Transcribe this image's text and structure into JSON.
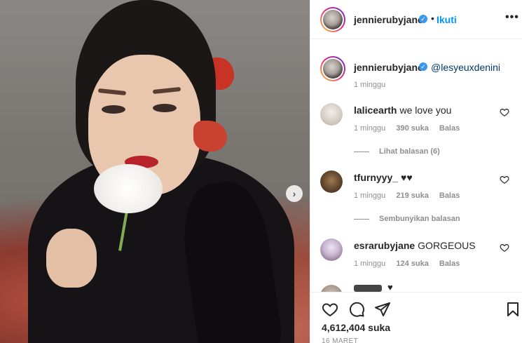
{
  "post": {
    "username": "jennierubyjane",
    "follow_label": "Ikuti",
    "dot": "•",
    "more_label": "•••",
    "next_label": "›"
  },
  "caption": {
    "username": "jennierubyjane",
    "mention": "@lesyeuxdenini",
    "time": "1 minggu"
  },
  "comments": [
    {
      "username": "lalicearth",
      "text": "we love you",
      "time": "1 minggu",
      "likes": "390 suka",
      "reply": "Balas",
      "toggle_label": "Lihat balasan (6)"
    },
    {
      "username": "tfurnyyy_",
      "text": "♥♥",
      "time": "1 minggu",
      "likes": "219 suka",
      "reply": "Balas",
      "toggle_label": "Sembunyikan balasan"
    },
    {
      "username": "esrarubyjane",
      "text": "GORGEOUS",
      "time": "1 minggu",
      "likes": "124 suka",
      "reply": "Balas"
    }
  ],
  "partial_comment": {
    "text": "♥"
  },
  "footer": {
    "likes": "4,612,404 suka",
    "date": "16 MARET"
  },
  "colors": {
    "link": "#0095f6",
    "verified": "#3897f0",
    "text": "#262626",
    "muted": "#8e8e8e"
  }
}
